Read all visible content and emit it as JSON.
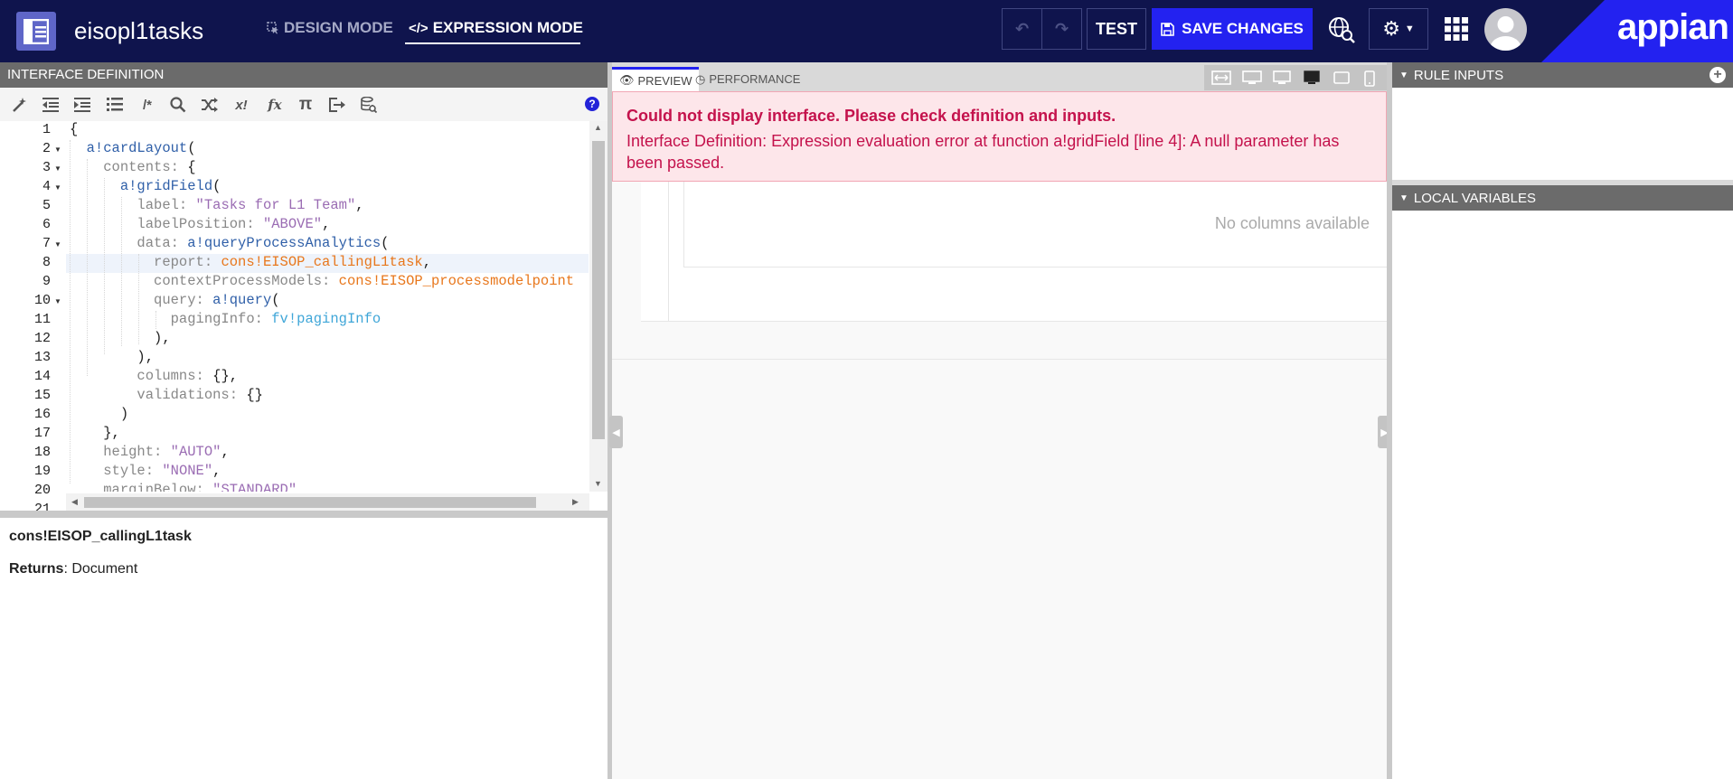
{
  "header": {
    "app_name": "eisopl1tasks",
    "tabs": [
      {
        "label": "DESIGN MODE",
        "active": false
      },
      {
        "label": "EXPRESSION MODE",
        "active": true
      }
    ],
    "test_label": "TEST",
    "save_label": "SAVE CHANGES",
    "logo_text": "appian",
    "colors": {
      "bar": "#0f144d",
      "accent": "#2322f0"
    }
  },
  "left_panel": {
    "title": "INTERFACE DEFINITION",
    "toolbar_icons": [
      "magic-wand-icon",
      "outdent-icon",
      "indent-icon",
      "list-icon",
      "comment-icon",
      "search-icon",
      "shuffle-icon",
      "variable-icon",
      "function-icon",
      "pi-icon",
      "export-icon",
      "database-search-icon",
      "help-icon"
    ],
    "toolbar_labels": {
      "comment": "/*",
      "variable": "x!",
      "function": "fx",
      "pi": "π",
      "help": "?"
    },
    "line_numbers": [
      "1",
      "2",
      "3",
      "4",
      "5",
      "6",
      "7",
      "8",
      "9",
      "10",
      "11",
      "12",
      "13",
      "14",
      "15",
      "16",
      "17",
      "18",
      "19",
      "20",
      "21"
    ],
    "code": {
      "l1_p": "{",
      "l2_fn": "a!cardLayout",
      "l2_p": "(",
      "l3_k": "contents: ",
      "l3_p": "{",
      "l4_fn": "a!gridField",
      "l4_p": "(",
      "l5_k": "label: ",
      "l5_s": "\"Tasks for L1 Team\"",
      "l5_p": ",",
      "l6_k": "labelPosition: ",
      "l6_s": "\"ABOVE\"",
      "l6_p": ",",
      "l7_k": "data: ",
      "l7_fn": "a!queryProcessAnalytics",
      "l7_p": "(",
      "l8_k": "report: ",
      "l8_c": "cons!EISOP_callingL1task",
      "l8_p": ",",
      "l9_k": "contextProcessModels: ",
      "l9_c": "cons!EISOP_processmodelpoint",
      "l10_k": "query: ",
      "l10_fn": "a!query",
      "l10_p": "(",
      "l11_k": "pagingInfo: ",
      "l11_fv": "fv!pagingInfo",
      "l12_p": "),",
      "l13_p": "),",
      "l14_k": "columns: ",
      "l14_p": "{},",
      "l15_k": "validations: ",
      "l15_p": "{}",
      "l16_p": ")",
      "l17_p": "},",
      "l18_k": "height: ",
      "l18_s": "\"AUTO\"",
      "l18_p": ",",
      "l19_k": "style: ",
      "l19_s": "\"NONE\"",
      "l19_p": ",",
      "l20_k": "marginBelow: ",
      "l20_s": "\"STANDARD\""
    },
    "doc": {
      "title": "cons!EISOP_callingL1task",
      "returns_label": "Returns",
      "returns_value": ": Document"
    }
  },
  "preview": {
    "tabs": [
      {
        "label": "PREVIEW",
        "icon": "eye-icon",
        "active": true
      },
      {
        "label": "PERFORMANCE",
        "icon": "clock-icon",
        "active": false
      }
    ],
    "devices": [
      "fit-width-icon",
      "desktop-wide-icon",
      "desktop-icon",
      "tablet-landscape-icon",
      "tablet-portrait-icon",
      "phone-icon"
    ],
    "error_title": "Could not display interface. Please check definition and inputs.",
    "error_message": "Interface Definition: Expression evaluation error at function a!gridField [line 4]: A null parameter has been passed.",
    "no_columns": "No columns available",
    "colors": {
      "error_text": "#c4124c",
      "error_bg": "#fde6ea"
    }
  },
  "right_panel": {
    "rule_inputs": "RULE INPUTS",
    "local_variables": "LOCAL VARIABLES"
  }
}
